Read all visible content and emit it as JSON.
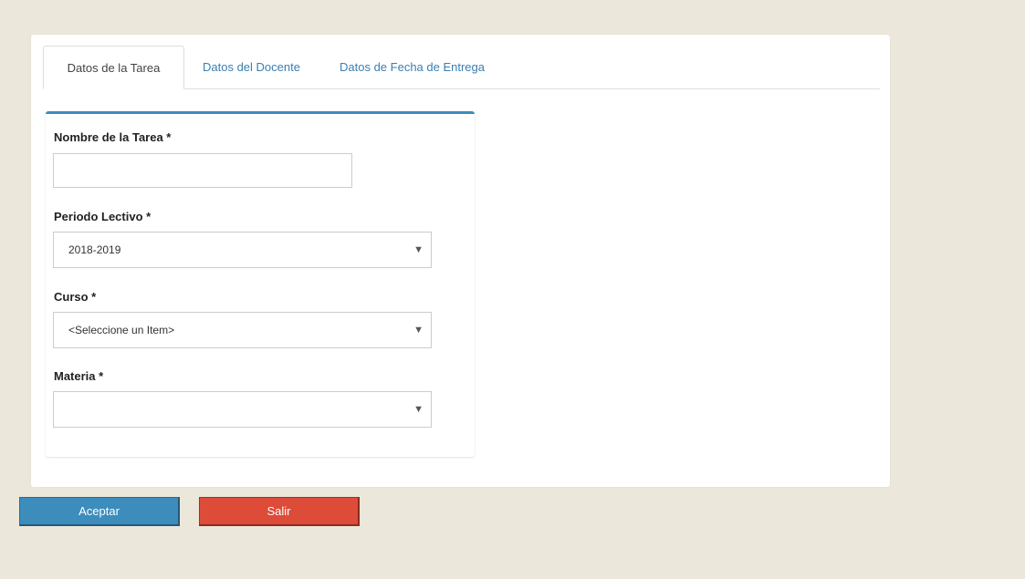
{
  "tabs": [
    {
      "label": "Datos de la Tarea"
    },
    {
      "label": "Datos del Docente"
    },
    {
      "label": "Datos de Fecha de Entrega"
    }
  ],
  "form": {
    "task_name": {
      "label": "Nombre de la Tarea *",
      "value": ""
    },
    "period": {
      "label": "Periodo Lectivo *",
      "value": "2018-2019"
    },
    "course": {
      "label": "Curso *",
      "value": "<Seleccione un Item>"
    },
    "subject": {
      "label": "Materia *",
      "value": ""
    }
  },
  "icons": {
    "dropdown": "▼"
  },
  "buttons": {
    "accept": "Aceptar",
    "exit": "Salir"
  },
  "colors": {
    "accent": "#3c8dbc",
    "danger": "#dd4b39",
    "background": "#ebe7da"
  }
}
